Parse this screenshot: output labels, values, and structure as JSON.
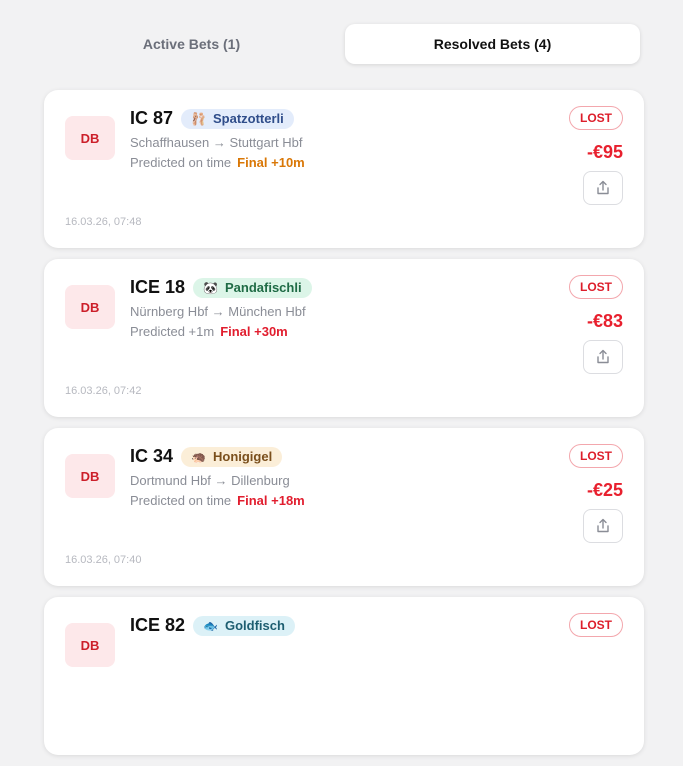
{
  "tabs": [
    {
      "label": "Active Bets (1)",
      "active": false
    },
    {
      "label": "Resolved Bets (4)",
      "active": true
    }
  ],
  "bets": [
    {
      "operator": "DB",
      "train": "IC 87",
      "chip": {
        "emoji": "🩰",
        "label": "Spatzotterli",
        "bg": "#e3ecfb",
        "color": "#2f4d8a"
      },
      "route": "Schaffhausen → Stuttgart Hbf",
      "predicted": "Predicted on time",
      "final": "Final +10m",
      "final_color": "#d97706",
      "date": "16.03.26, 07:48",
      "status": "LOST",
      "amount": "-€95"
    },
    {
      "operator": "DB",
      "train": "ICE 18",
      "chip": {
        "emoji": "🐼",
        "label": "Pandafischli",
        "bg": "#dcf5e8",
        "color": "#1f6b45"
      },
      "route": "Nürnberg Hbf → München Hbf",
      "predicted": "Predicted +1m",
      "final": "Final +30m",
      "final_color": "#e11d2e",
      "date": "16.03.26, 07:42",
      "status": "LOST",
      "amount": "-€83"
    },
    {
      "operator": "DB",
      "train": "IC 34",
      "chip": {
        "emoji": "🦔",
        "label": "Honigigel",
        "bg": "#fbeed8",
        "color": "#7a4f1c"
      },
      "route": "Dortmund Hbf → Dillenburg",
      "predicted": "Predicted on time",
      "final": "Final +18m",
      "final_color": "#e11d2e",
      "date": "16.03.26, 07:40",
      "status": "LOST",
      "amount": "-€25"
    },
    {
      "operator": "DB",
      "train": "ICE 82",
      "chip": {
        "emoji": "🐟",
        "label": "Goldfisch",
        "bg": "#dcf1f7",
        "color": "#1d5d70"
      },
      "route": "",
      "predicted": "",
      "final": "",
      "final_color": "#e11d2e",
      "date": "",
      "status": "LOST",
      "amount": ""
    }
  ]
}
